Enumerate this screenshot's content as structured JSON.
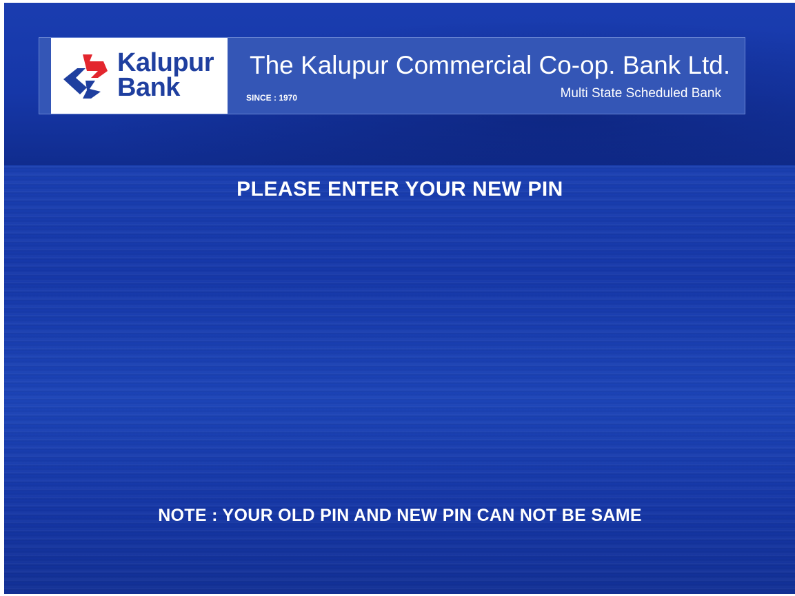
{
  "header": {
    "logo_name": "Kalupur",
    "logo_word": "Bank",
    "bank_name": "The Kalupur Commercial Co-op. Bank Ltd.",
    "since": "SINCE : 1970",
    "tagline": "Multi State Scheduled Bank"
  },
  "main": {
    "prompt": "PLEASE ENTER YOUR NEW PIN",
    "note": "NOTE : YOUR OLD PIN AND NEW PIN CAN NOT BE SAME"
  },
  "colors": {
    "background_blue": "#1638aa",
    "banner_blue": "#3456b6",
    "logo_red": "#e3262e",
    "logo_blue": "#1f3f9f"
  },
  "icons": {
    "logo": "kalupur-bank-logo"
  }
}
